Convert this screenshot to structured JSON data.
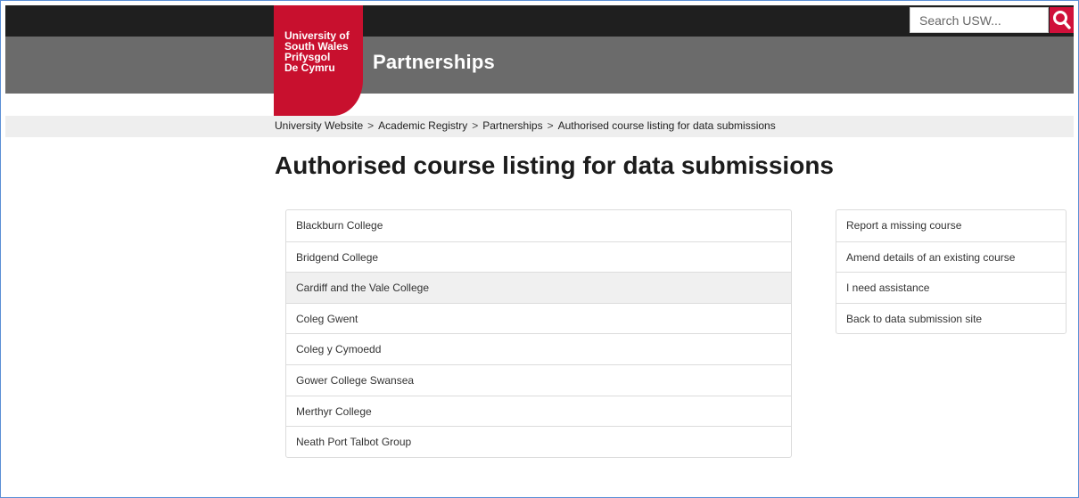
{
  "header": {
    "logo_lines": [
      "University of",
      "South Wales",
      "Prifysgol",
      "De Cymru"
    ],
    "site_title": "Partnerships",
    "search_placeholder": "Search USW...",
    "brand_color": "#c8102e"
  },
  "breadcrumb": [
    "University Website",
    "Academic Registry",
    "Partnerships",
    "Authorised course listing for data submissions"
  ],
  "breadcrumb_separator": ">",
  "page_title": "Authorised course listing for data submissions",
  "colleges": [
    "Blackburn College",
    "Bridgend College",
    "Cardiff and the Vale College",
    "Coleg Gwent",
    "Coleg y Cymoedd",
    "Gower College Swansea",
    "Merthyr College",
    "Neath Port Talbot Group"
  ],
  "sidebar_links": [
    "Report a missing course",
    "Amend details of an existing course",
    "I need assistance",
    "Back to data submission site"
  ],
  "icons": {
    "search": "search-icon"
  }
}
